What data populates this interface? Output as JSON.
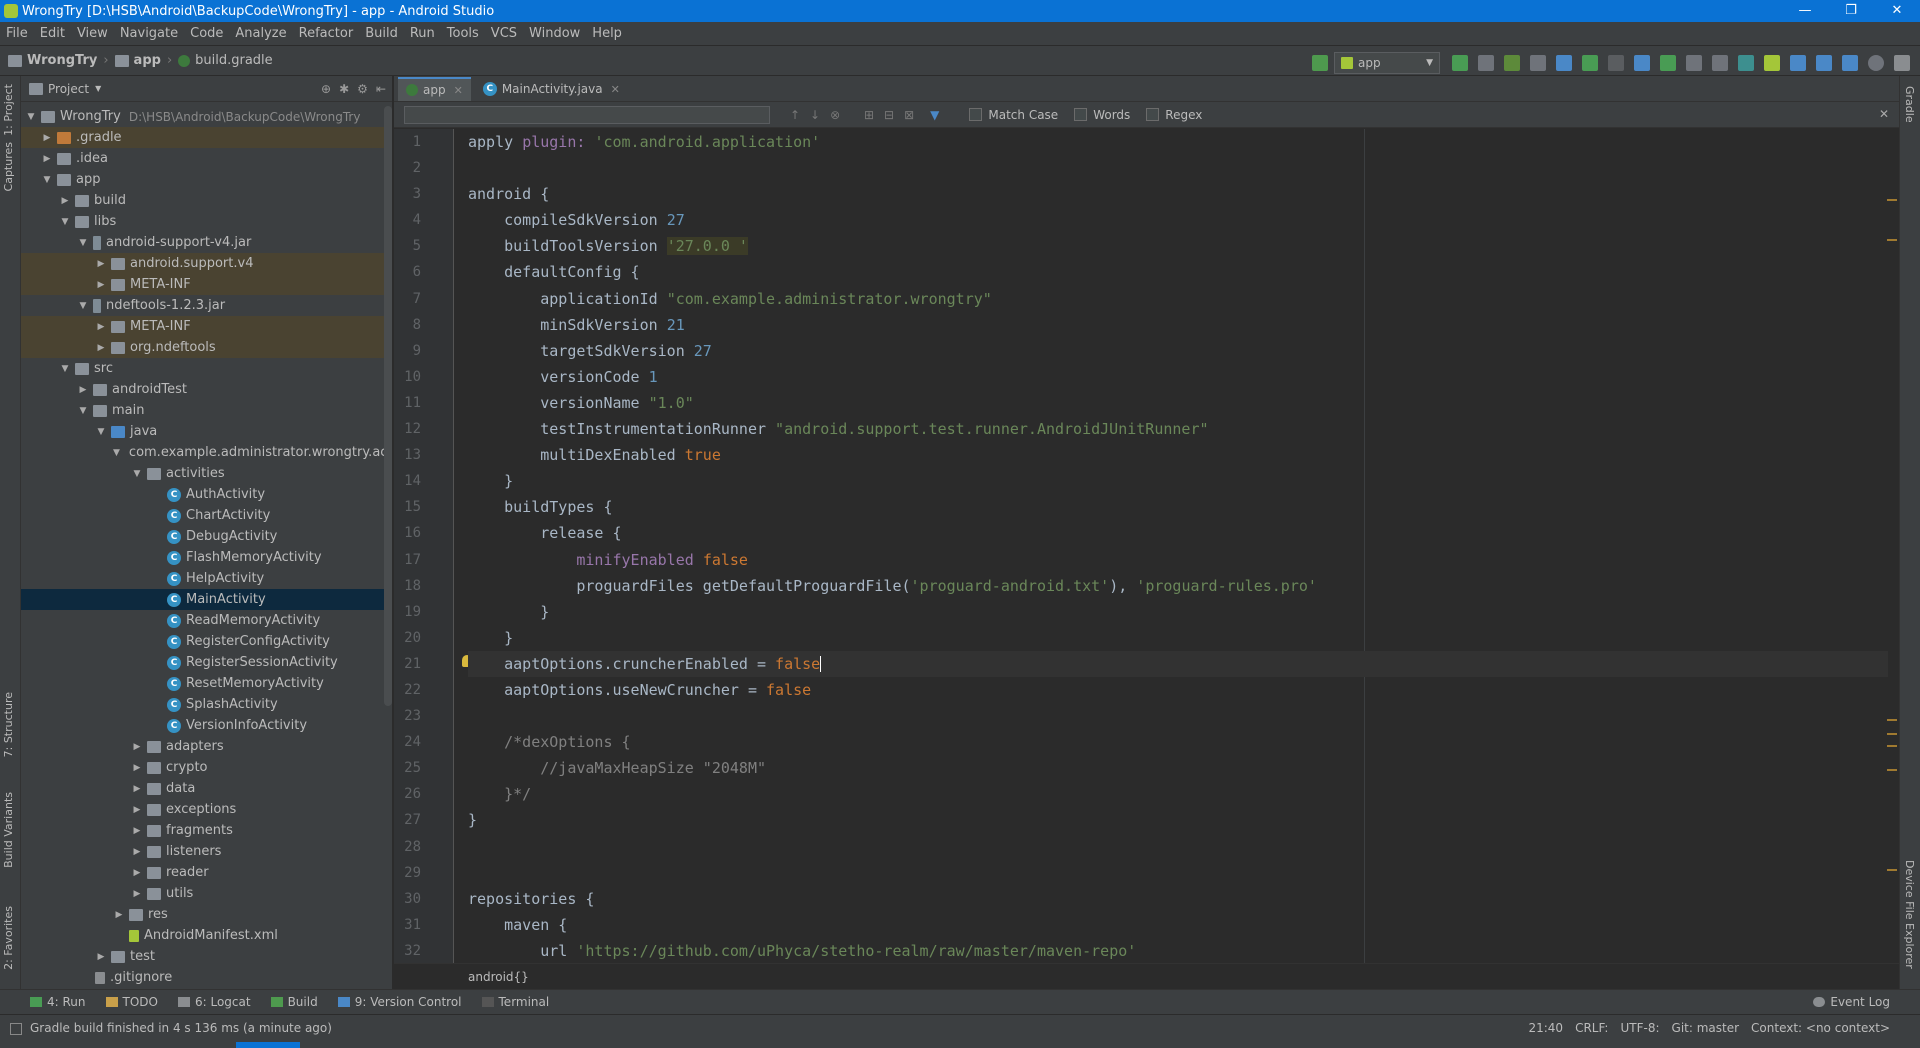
{
  "window": {
    "title": "WrongTry [D:\\HSB\\Android\\BackupCode\\WrongTry] - app - Android Studio",
    "minimize": "—",
    "maximize": "❐",
    "close": "✕"
  },
  "menu": [
    "File",
    "Edit",
    "View",
    "Navigate",
    "Code",
    "Analyze",
    "Refactor",
    "Build",
    "Run",
    "Tools",
    "VCS",
    "Window",
    "Help"
  ],
  "breadcrumb": {
    "project": "WrongTry",
    "module": "app",
    "file": "build.gradle"
  },
  "run_config": "app",
  "left_tabs": {
    "project": "1: Project",
    "captures": "Captures",
    "structure": "7: Structure",
    "build_variants": "Build Variants",
    "favorites": "2: Favorites"
  },
  "right_tabs": {
    "gradle": "Gradle",
    "device_explorer": "Device File Explorer"
  },
  "project_panel": {
    "header": "Project",
    "root_name": "WrongTry",
    "root_path": "D:\\HSB\\Android\\BackupCode\\WrongTry",
    "items": [
      {
        "label": ".gradle"
      },
      {
        "label": ".idea"
      },
      {
        "label": "app"
      },
      {
        "label": "build"
      },
      {
        "label": "libs"
      },
      {
        "label": "android-support-v4.jar"
      },
      {
        "label": "android.support.v4"
      },
      {
        "label": "META-INF"
      },
      {
        "label": "ndeftools-1.2.3.jar"
      },
      {
        "label": "META-INF"
      },
      {
        "label": "org.ndeftools"
      },
      {
        "label": "src"
      },
      {
        "label": "androidTest"
      },
      {
        "label": "main"
      },
      {
        "label": "java"
      },
      {
        "label": "com.example.administrator.wrongtry.activ"
      },
      {
        "label": "activities"
      },
      {
        "label": "AuthActivity"
      },
      {
        "label": "ChartActivity"
      },
      {
        "label": "DebugActivity"
      },
      {
        "label": "FlashMemoryActivity"
      },
      {
        "label": "HelpActivity"
      },
      {
        "label": "MainActivity"
      },
      {
        "label": "ReadMemoryActivity"
      },
      {
        "label": "RegisterConfigActivity"
      },
      {
        "label": "RegisterSessionActivity"
      },
      {
        "label": "ResetMemoryActivity"
      },
      {
        "label": "SplashActivity"
      },
      {
        "label": "VersionInfoActivity"
      },
      {
        "label": "adapters"
      },
      {
        "label": "crypto"
      },
      {
        "label": "data"
      },
      {
        "label": "exceptions"
      },
      {
        "label": "fragments"
      },
      {
        "label": "listeners"
      },
      {
        "label": "reader"
      },
      {
        "label": "utils"
      },
      {
        "label": "res"
      },
      {
        "label": "AndroidManifest.xml"
      },
      {
        "label": "test"
      },
      {
        "label": ".gitignore"
      }
    ]
  },
  "editor": {
    "tabs": [
      {
        "label": "app"
      },
      {
        "label": "MainActivity.java"
      }
    ],
    "find": {
      "match_case": "Match Case",
      "words": "Words",
      "regex": "Regex"
    },
    "line_numbers": [
      "1",
      "2",
      "3",
      "4",
      "5",
      "6",
      "7",
      "8",
      "9",
      "10",
      "11",
      "12",
      "13",
      "14",
      "15",
      "16",
      "17",
      "18",
      "19",
      "20",
      "21",
      "22",
      "23",
      "24",
      "25",
      "26",
      "27",
      "28",
      "29",
      "30",
      "31",
      "32"
    ],
    "lines": [
      {
        "text": "apply plugin: 'com.android.application'"
      },
      {
        "text": ""
      },
      {
        "text": "android {"
      },
      {
        "text": "    compileSdkVersion 27"
      },
      {
        "text": "    buildToolsVersion '27.0.0 '"
      },
      {
        "text": "    defaultConfig {"
      },
      {
        "text": "        applicationId \"com.example.administrator.wrongtry\""
      },
      {
        "text": "        minSdkVersion 21"
      },
      {
        "text": "        targetSdkVersion 27"
      },
      {
        "text": "        versionCode 1"
      },
      {
        "text": "        versionName \"1.0\""
      },
      {
        "text": "        testInstrumentationRunner \"android.support.test.runner.AndroidJUnitRunner\""
      },
      {
        "text": "        multiDexEnabled true"
      },
      {
        "text": "    }"
      },
      {
        "text": "    buildTypes {"
      },
      {
        "text": "        release {"
      },
      {
        "text": "            minifyEnabled false"
      },
      {
        "text": "            proguardFiles getDefaultProguardFile('proguard-android.txt'), 'proguard-rules.pro'"
      },
      {
        "text": "        }"
      },
      {
        "text": "    }"
      },
      {
        "text": "    aaptOptions.cruncherEnabled = false"
      },
      {
        "text": "    aaptOptions.useNewCruncher = false"
      },
      {
        "text": ""
      },
      {
        "text": "    /*dexOptions {"
      },
      {
        "text": "        //javaMaxHeapSize \"2048M\""
      },
      {
        "text": "    }*/"
      },
      {
        "text": "}"
      },
      {
        "text": ""
      },
      {
        "text": ""
      },
      {
        "text": "repositories {"
      },
      {
        "text": "    maven {"
      },
      {
        "text": "        url 'https://github.com/uPhyca/stetho-realm/raw/master/maven-repo'"
      }
    ],
    "breadcrumb": "android{}"
  },
  "bottom_tabs": [
    {
      "label": "4: Run"
    },
    {
      "label": "TODO"
    },
    {
      "label": "6: Logcat"
    },
    {
      "label": "Build"
    },
    {
      "label": "9: Version Control"
    },
    {
      "label": "Terminal"
    }
  ],
  "event_log": "Event Log",
  "status": {
    "message": "Gradle build finished in 4 s 136 ms (a minute ago)",
    "position": "21:40",
    "line_sep": "CRLF:",
    "encoding": "UTF-8:",
    "git": "Git: master",
    "context": "Context: <no context>"
  }
}
